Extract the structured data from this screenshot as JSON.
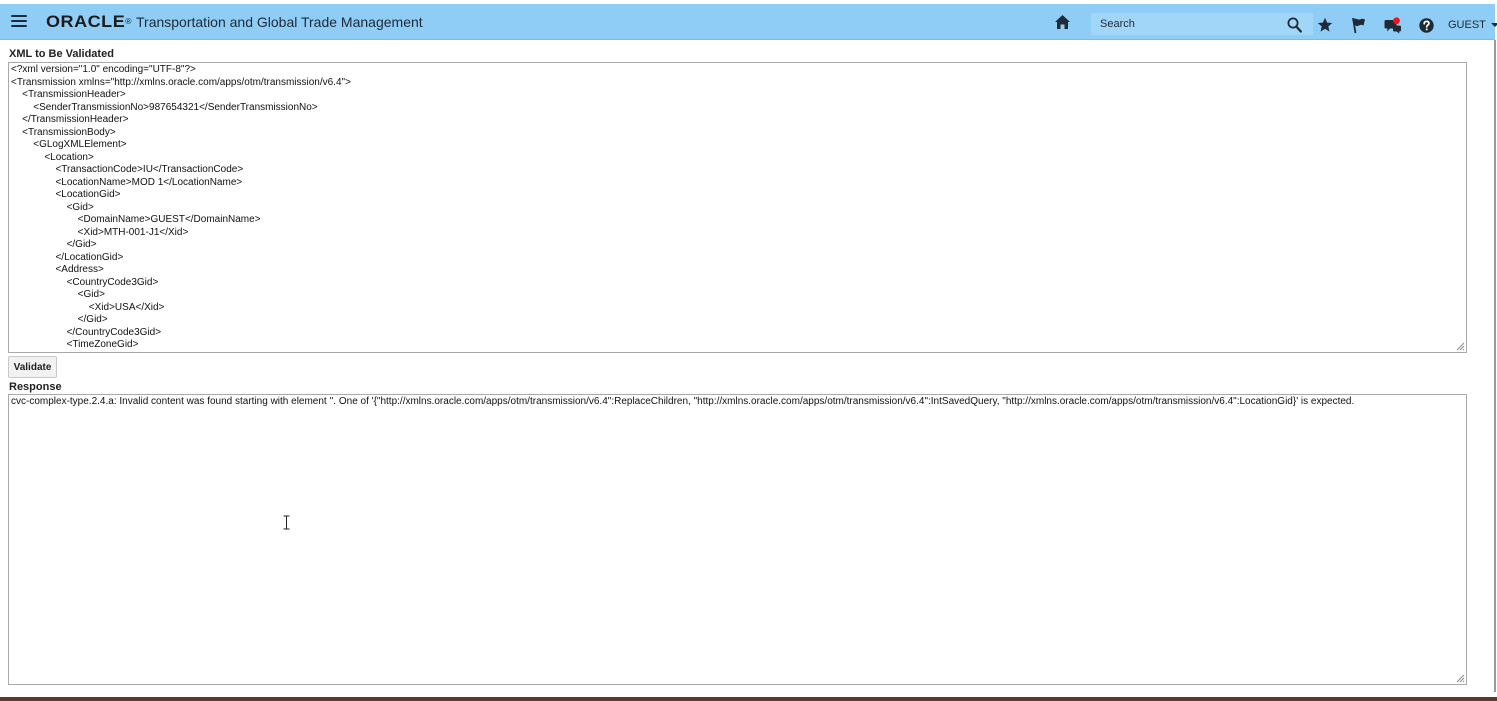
{
  "header": {
    "menu_icon": "hamburger-menu-icon",
    "logo_text": "ORACLE",
    "logo_reg": "®",
    "app_title": "Transportation and Global Trade Management",
    "home_icon": "home-icon",
    "search": {
      "placeholder": "Search",
      "value": ""
    },
    "icons": [
      "search-icon",
      "star-icon",
      "flag-icon",
      "chat-icon",
      "help-icon"
    ],
    "user": "GUEST",
    "bar_color": "#8fcdf7"
  },
  "main": {
    "xml_label": "XML to Be Validated",
    "xml_content": "<?xml version=\"1.0\" encoding=\"UTF-8\"?>\n<Transmission xmlns=\"http://xmlns.oracle.com/apps/otm/transmission/v6.4\">\n    <TransmissionHeader>\n        <SenderTransmissionNo>987654321</SenderTransmissionNo>\n    </TransmissionHeader>\n    <TransmissionBody>\n        <GLogXMLElement>\n            <Location>\n                <TransactionCode>IU</TransactionCode>\n                <LocationName>MOD 1</LocationName>\n                <LocationGid>\n                    <Gid>\n                        <DomainName>GUEST</DomainName>\n                        <Xid>MTH-001-J1</Xid>\n                    </Gid>\n                </LocationGid>\n                <Address>\n                    <CountryCode3Gid>\n                        <Gid>\n                            <Xid>USA</Xid>\n                        </Gid>\n                    </CountryCode3Gid>\n                    <TimeZoneGid>",
    "validate_label": "Validate",
    "response_label": "Response",
    "response_content": "cvc-complex-type.2.4.a: Invalid content was found starting with element ''. One of '{\"http://xmlns.oracle.com/apps/otm/transmission/v6.4\":ReplaceChildren, \"http://xmlns.oracle.com/apps/otm/transmission/v6.4\":IntSavedQuery, \"http://xmlns.oracle.com/apps/otm/transmission/v6.4\":LocationGid}' is expected."
  }
}
